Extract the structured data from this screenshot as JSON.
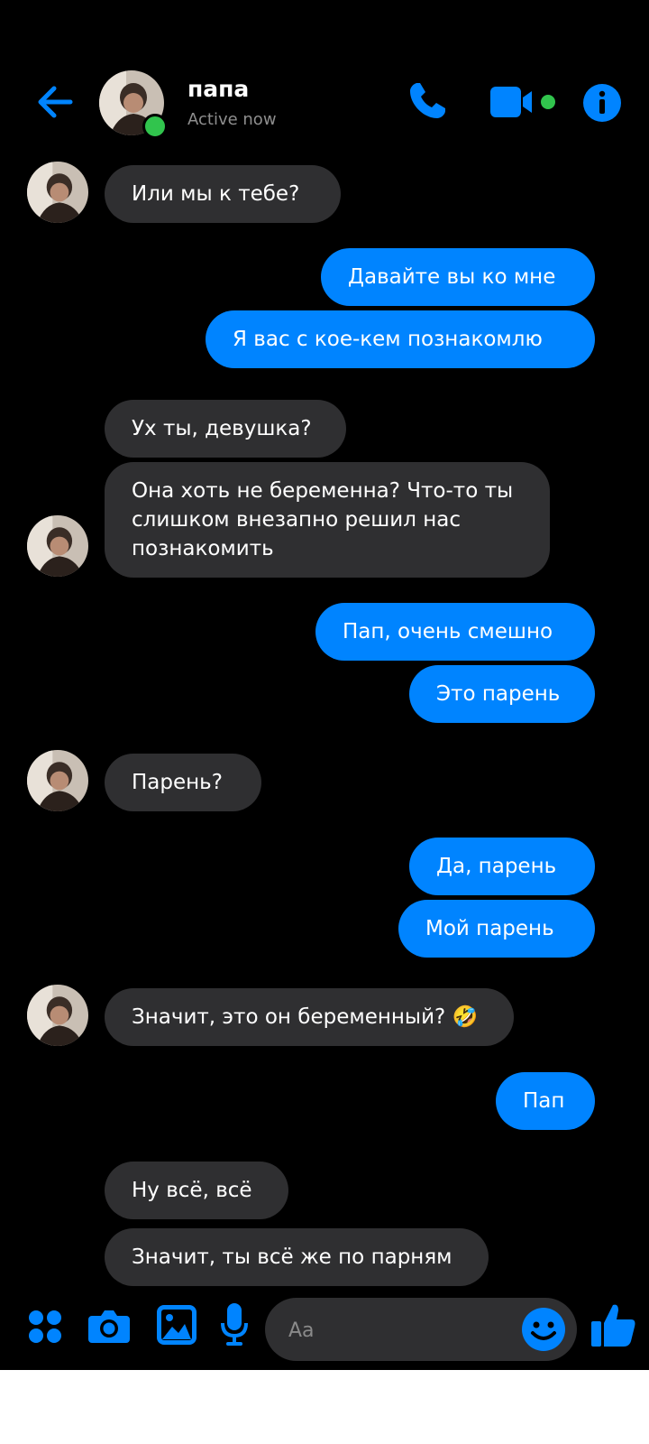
{
  "header": {
    "contact_name": "папа",
    "status": "Active now"
  },
  "messages": [
    {
      "id": "m1",
      "direction": "incoming",
      "text": "Или мы к тебе?"
    },
    {
      "id": "m2",
      "direction": "outgoing",
      "text": "Давайте вы ко мне"
    },
    {
      "id": "m3",
      "direction": "outgoing",
      "text": "Я вас с кое-кем  познакомлю"
    },
    {
      "id": "m4",
      "direction": "incoming",
      "text": "Ух ты, девушка?"
    },
    {
      "id": "m5",
      "direction": "incoming",
      "text": "Она хоть не беременна? Что-то ты слишком внезапно решил нас познакомить"
    },
    {
      "id": "m6",
      "direction": "outgoing",
      "text": "Пап, очень смешно"
    },
    {
      "id": "m7",
      "direction": "outgoing",
      "text": "Это парень"
    },
    {
      "id": "m8",
      "direction": "incoming",
      "text": "Парень?"
    },
    {
      "id": "m9",
      "direction": "outgoing",
      "text": "Да, парень"
    },
    {
      "id": "m10",
      "direction": "outgoing",
      "text": "Мой парень"
    },
    {
      "id": "m11",
      "direction": "incoming",
      "text": "Значит, это он беременный? 🤣"
    },
    {
      "id": "m12",
      "direction": "outgoing",
      "text": "Пап"
    },
    {
      "id": "m13",
      "direction": "incoming",
      "text": "Ну всё, всё"
    },
    {
      "id": "m14",
      "direction": "incoming",
      "text": "Значит, ты всё же по парням"
    }
  ],
  "composer": {
    "placeholder": "Aa"
  },
  "icons": {
    "back": "arrow-left-icon",
    "call": "phone-icon",
    "video": "video-camera-icon",
    "info": "info-icon",
    "apps": "four-dots-icon",
    "camera": "camera-icon",
    "gallery": "image-icon",
    "mic": "microphone-icon",
    "emoji": "smiley-icon",
    "like": "thumbs-up-icon"
  },
  "colors": {
    "accent": "#0084ff",
    "incoming_bubble": "#2f2f31",
    "background": "#000000",
    "online": "#31c44d"
  }
}
